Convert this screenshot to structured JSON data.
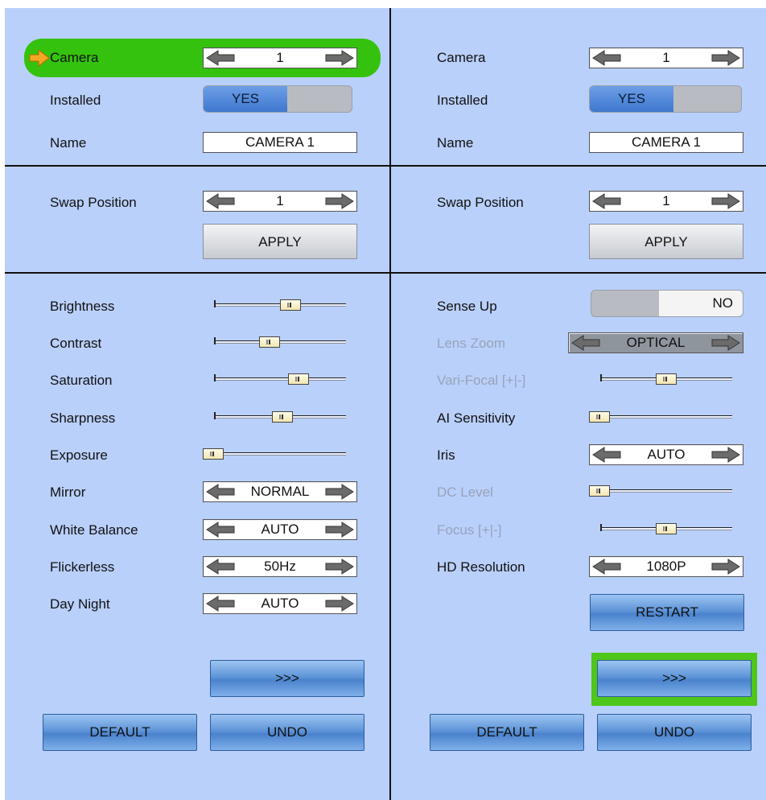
{
  "left": {
    "camera": {
      "label": "Camera",
      "value": "1"
    },
    "installed": {
      "label": "Installed",
      "yes": "YES"
    },
    "name": {
      "label": "Name",
      "value": "CAMERA 1"
    },
    "swap": {
      "label": "Swap Position",
      "value": "1",
      "apply": "APPLY"
    },
    "brightness": {
      "label": "Brightness",
      "level": 0.58
    },
    "contrast": {
      "label": "Contrast",
      "level": 0.42
    },
    "saturation": {
      "label": "Saturation",
      "level": 0.64
    },
    "sharpness": {
      "label": "Sharpness",
      "level": 0.52
    },
    "exposure": {
      "label": "Exposure",
      "level": 0.03
    },
    "mirror": {
      "label": "Mirror",
      "value": "NORMAL"
    },
    "white_balance": {
      "label": "White Balance",
      "value": "AUTO"
    },
    "flickerless": {
      "label": "Flickerless",
      "value": "50Hz"
    },
    "day_night": {
      "label": "Day Night",
      "value": "AUTO"
    },
    "next": ">>>",
    "default": "DEFAULT",
    "undo": "UNDO"
  },
  "right": {
    "camera": {
      "label": "Camera",
      "value": "1"
    },
    "installed": {
      "label": "Installed",
      "yes": "YES"
    },
    "name": {
      "label": "Name",
      "value": "CAMERA 1"
    },
    "swap": {
      "label": "Swap Position",
      "value": "1",
      "apply": "APPLY"
    },
    "sense_up": {
      "label": "Sense Up",
      "value": "NO"
    },
    "lens_zoom": {
      "label": "Lens Zoom",
      "value": "OPTICAL"
    },
    "vari_focal": {
      "label": "Vari-Focal [+|-]",
      "level": 0.5
    },
    "ai_sensitivity": {
      "label": "AI Sensitivity",
      "level": 0.03
    },
    "iris": {
      "label": "Iris",
      "value": "AUTO"
    },
    "dc_level": {
      "label": "DC Level",
      "level": 0.03
    },
    "focus": {
      "label": "Focus [+|-]",
      "level": 0.5
    },
    "hd_resolution": {
      "label": "HD Resolution",
      "value": "1080P"
    },
    "restart": "RESTART",
    "next": ">>>",
    "default": "DEFAULT",
    "undo": "UNDO"
  },
  "colors": {
    "background": "#b9d0fb",
    "highlight": "#35c20e",
    "focus": "#4ec61a",
    "arrow": "#6b6b6b",
    "focus_arrow": "#f5a623"
  }
}
